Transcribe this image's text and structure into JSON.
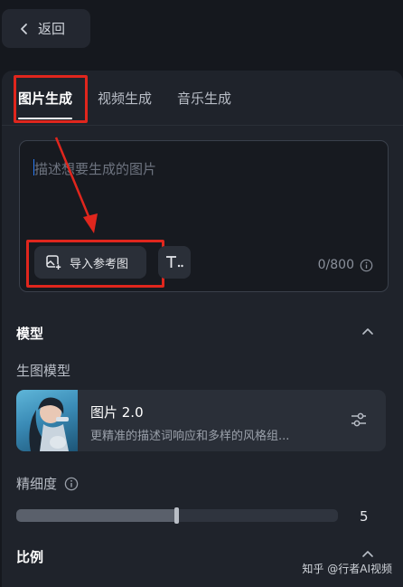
{
  "back": {
    "label": "返回",
    "icon": "chevron-left-icon"
  },
  "tabs": [
    {
      "label": "图片生成",
      "active": true
    },
    {
      "label": "视频生成",
      "active": false
    },
    {
      "label": "音乐生成",
      "active": false
    }
  ],
  "prompt": {
    "placeholder": "描述想要生成的图片",
    "ref_button_label": "导入参考图",
    "counter": "0/800"
  },
  "model_section": {
    "title": "模型",
    "sub_label": "生图模型",
    "card": {
      "name": "图片 2.0",
      "description": "更精准的描述词响应和多样的风格组..."
    }
  },
  "detail": {
    "label": "精细度",
    "value_text": "5",
    "fraction": 0.5
  },
  "ratio_section": {
    "title": "比例"
  },
  "watermark": "知乎 @行者AI视频",
  "colors": {
    "annotation_red": "#e0261d",
    "panel_bg": "#1f232b",
    "page_bg": "#15181e"
  }
}
